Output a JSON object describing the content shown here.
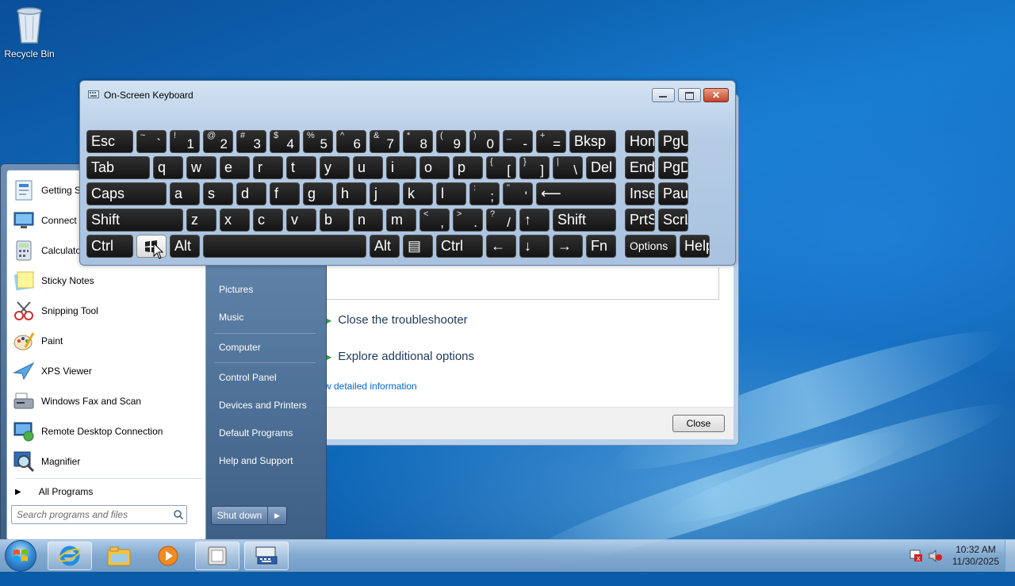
{
  "desktop": {
    "recycle_bin_label": "Recycle Bin"
  },
  "troubleshooter": {
    "option_close": "Close the troubleshooter",
    "option_explore": "Explore additional options",
    "details_link": "w detailed information",
    "close_button": "Close"
  },
  "start_menu": {
    "programs": [
      {
        "label": "Getting S",
        "icon": "getting-started-icon"
      },
      {
        "label": "Connect",
        "icon": "connect-projector-icon"
      },
      {
        "label": "Calculato",
        "icon": "calculator-icon"
      },
      {
        "label": "Sticky Notes",
        "icon": "sticky-notes-icon"
      },
      {
        "label": "Snipping Tool",
        "icon": "snipping-tool-icon"
      },
      {
        "label": "Paint",
        "icon": "paint-icon"
      },
      {
        "label": "XPS Viewer",
        "icon": "xps-viewer-icon"
      },
      {
        "label": "Windows Fax and Scan",
        "icon": "fax-scan-icon"
      },
      {
        "label": "Remote Desktop Connection",
        "icon": "remote-desktop-icon"
      },
      {
        "label": "Magnifier",
        "icon": "magnifier-icon"
      }
    ],
    "all_programs": "All Programs",
    "search_placeholder": "Search programs and files",
    "right_items": [
      "Pictures",
      "Music",
      "Computer",
      "Control Panel",
      "Devices and Printers",
      "Default Programs",
      "Help and Support"
    ],
    "shutdown_label": "Shut down"
  },
  "osk": {
    "title": "On-Screen Keyboard",
    "rows": [
      [
        {
          "id": "esc",
          "main": "Esc"
        },
        {
          "id": "tilde",
          "shift": "~",
          "base": "`"
        },
        {
          "id": "1",
          "shift": "!",
          "base": "1"
        },
        {
          "id": "2",
          "shift": "@",
          "base": "2"
        },
        {
          "id": "3",
          "shift": "#",
          "base": "3"
        },
        {
          "id": "4",
          "shift": "$",
          "base": "4"
        },
        {
          "id": "5",
          "shift": "%",
          "base": "5"
        },
        {
          "id": "6",
          "shift": "^",
          "base": "6"
        },
        {
          "id": "7",
          "shift": "&",
          "base": "7"
        },
        {
          "id": "8",
          "shift": "*",
          "base": "8"
        },
        {
          "id": "9",
          "shift": "(",
          "base": "9"
        },
        {
          "id": "0",
          "shift": ")",
          "base": "0"
        },
        {
          "id": "minus",
          "shift": "_",
          "base": "-"
        },
        {
          "id": "equals",
          "shift": "+",
          "base": "="
        },
        {
          "id": "bksp",
          "main": "Bksp"
        },
        {
          "id": "home",
          "main": "Home"
        },
        {
          "id": "pgup",
          "main": "PgUp"
        }
      ],
      [
        {
          "id": "tab",
          "main": "Tab"
        },
        {
          "id": "q",
          "main": "q"
        },
        {
          "id": "w",
          "main": "w"
        },
        {
          "id": "e",
          "main": "e"
        },
        {
          "id": "r",
          "main": "r"
        },
        {
          "id": "t",
          "main": "t"
        },
        {
          "id": "y",
          "main": "y"
        },
        {
          "id": "u",
          "main": "u"
        },
        {
          "id": "i",
          "main": "i"
        },
        {
          "id": "o",
          "main": "o"
        },
        {
          "id": "p",
          "main": "p"
        },
        {
          "id": "lbracket",
          "shift": "{",
          "base": "["
        },
        {
          "id": "rbracket",
          "shift": "}",
          "base": "]"
        },
        {
          "id": "backslash",
          "shift": "|",
          "base": "\\"
        },
        {
          "id": "del",
          "main": "Del"
        },
        {
          "id": "end",
          "main": "End"
        },
        {
          "id": "pgdn",
          "main": "PgDn"
        }
      ],
      [
        {
          "id": "caps",
          "main": "Caps"
        },
        {
          "id": "a",
          "main": "a"
        },
        {
          "id": "s",
          "main": "s"
        },
        {
          "id": "d",
          "main": "d"
        },
        {
          "id": "f",
          "main": "f"
        },
        {
          "id": "g",
          "main": "g"
        },
        {
          "id": "h",
          "main": "h"
        },
        {
          "id": "j",
          "main": "j"
        },
        {
          "id": "k",
          "main": "k"
        },
        {
          "id": "l",
          "main": "l"
        },
        {
          "id": "semicolon",
          "shift": ":",
          "base": ";"
        },
        {
          "id": "quote",
          "shift": "\"",
          "base": "'"
        },
        {
          "id": "enter",
          "main": "⟵"
        },
        {
          "id": "insert",
          "main": "Insert"
        },
        {
          "id": "pause",
          "main": "Pause"
        }
      ],
      [
        {
          "id": "lshift",
          "main": "Shift"
        },
        {
          "id": "z",
          "main": "z"
        },
        {
          "id": "x",
          "main": "x"
        },
        {
          "id": "c",
          "main": "c"
        },
        {
          "id": "v",
          "main": "v"
        },
        {
          "id": "b",
          "main": "b"
        },
        {
          "id": "n",
          "main": "n"
        },
        {
          "id": "m",
          "main": "m"
        },
        {
          "id": "comma",
          "shift": "<",
          "base": ","
        },
        {
          "id": "period",
          "shift": ">",
          "base": "."
        },
        {
          "id": "slash",
          "shift": "?",
          "base": "/"
        },
        {
          "id": "up",
          "main": "↑"
        },
        {
          "id": "rshift",
          "main": "Shift"
        },
        {
          "id": "prtscn",
          "main": "PrtScn"
        },
        {
          "id": "scrlk",
          "main": "ScrLk"
        }
      ],
      [
        {
          "id": "lctrl",
          "main": "Ctrl"
        },
        {
          "id": "win",
          "main": ""
        },
        {
          "id": "lalt",
          "main": "Alt"
        },
        {
          "id": "space",
          "main": ""
        },
        {
          "id": "ralt",
          "main": "Alt"
        },
        {
          "id": "menu",
          "main": "▤"
        },
        {
          "id": "rctrl",
          "main": "Ctrl"
        },
        {
          "id": "left",
          "main": "←"
        },
        {
          "id": "down",
          "main": "↓"
        },
        {
          "id": "right",
          "main": "→"
        },
        {
          "id": "fn",
          "main": "Fn"
        },
        {
          "id": "options",
          "main": "Options"
        },
        {
          "id": "help",
          "main": "Help"
        }
      ]
    ]
  },
  "taskbar": {
    "buttons": [
      "start-orb",
      "internet-explorer-icon",
      "windows-explorer-icon",
      "media-player-icon",
      "troubleshooter-window-icon",
      "on-screen-keyboard-icon"
    ],
    "time": "10:32 AM",
    "date": "11/30/2025"
  }
}
